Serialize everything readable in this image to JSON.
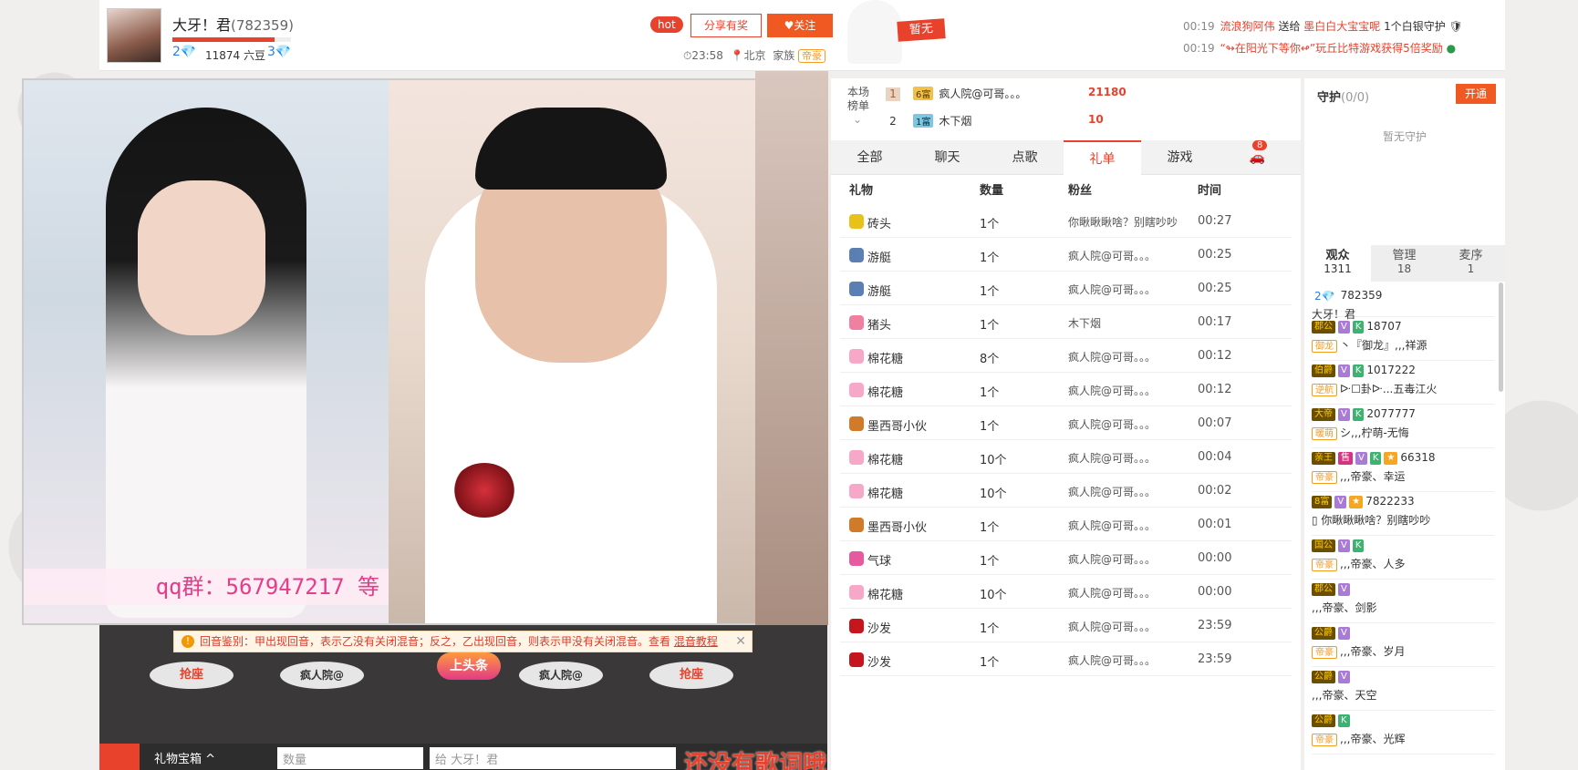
{
  "header": {
    "anchor_name": "大牙！君",
    "anchor_id": "(782359)",
    "level_left": "2💎",
    "beans": "11874 六豆",
    "level_right": "3💎",
    "hot": "hot",
    "share": "分享有奖",
    "follow": "♥关注",
    "time": "⏱23:58",
    "location": "📍北京",
    "family_label": "家族",
    "family_badge": "帝豪",
    "no_badge": "暂无",
    "news": [
      {
        "time": "00:19",
        "parts": [
          "流浪狗阿伟",
          "送给",
          "墨白白大宝宝呢",
          "1个白银守护"
        ]
      },
      {
        "time": "00:19",
        "parts": [
          "“↬在阳光下等你↫”玩丘比特游戏获得5倍奖励"
        ]
      }
    ]
  },
  "video": {
    "qq_text": "qq群：567947217 等"
  },
  "notice": {
    "text": "回音鉴别：甲出现回音，表示乙没有关闭混音；反之，乙出现回音，则表示甲没有关闭混音。查看",
    "link": "混音教程",
    "close": "✕"
  },
  "seats": [
    "抢座",
    "疯人院@",
    "上头条",
    "疯人院@",
    "抢座"
  ],
  "giftbar": {
    "label": "礼物宝箱 ^",
    "qty_placeholder": "数量",
    "to_placeholder": "给 大牙！君"
  },
  "lyric": "还没有歌词哦",
  "rank": {
    "title": "本场榜单",
    "rows": [
      {
        "num": "1",
        "badge": "6富",
        "name": "疯人院@可哥。。。",
        "amount": "21180"
      },
      {
        "num": "2",
        "badge": "1富",
        "name": "木下烟",
        "amount": "10"
      }
    ]
  },
  "tabs": [
    "全部",
    "聊天",
    "点歌",
    "礼单",
    "游戏"
  ],
  "car_badge": "8",
  "gift_headers": [
    "礼物",
    "数量",
    "粉丝",
    "时间"
  ],
  "gifts": [
    {
      "name": "砖头",
      "qty": "1个",
      "fan": "你瞅瞅瞅啥？别瞎吵吵",
      "time": "00:27",
      "color": "#e8c21a"
    },
    {
      "name": "游艇",
      "qty": "1个",
      "fan": "疯人院@可哥。。。",
      "time": "00:25",
      "color": "#5b7fb2"
    },
    {
      "name": "游艇",
      "qty": "1个",
      "fan": "疯人院@可哥。。。",
      "time": "00:25",
      "color": "#5b7fb2"
    },
    {
      "name": "猪头",
      "qty": "1个",
      "fan": "木下烟",
      "time": "00:17",
      "color": "#f080a0"
    },
    {
      "name": "棉花糖",
      "qty": "8个",
      "fan": "疯人院@可哥。。。",
      "time": "00:12",
      "color": "#f7a8c8"
    },
    {
      "name": "棉花糖",
      "qty": "1个",
      "fan": "疯人院@可哥。。。",
      "time": "00:12",
      "color": "#f7a8c8"
    },
    {
      "name": "墨西哥小伙",
      "qty": "1个",
      "fan": "疯人院@可哥。。。",
      "time": "00:07",
      "color": "#d07a2a"
    },
    {
      "name": "棉花糖",
      "qty": "10个",
      "fan": "疯人院@可哥。。。",
      "time": "00:04",
      "color": "#f7a8c8"
    },
    {
      "name": "棉花糖",
      "qty": "10个",
      "fan": "疯人院@可哥。。。",
      "time": "00:02",
      "color": "#f7a8c8"
    },
    {
      "name": "墨西哥小伙",
      "qty": "1个",
      "fan": "疯人院@可哥。。。",
      "time": "00:01",
      "color": "#d07a2a"
    },
    {
      "name": "气球",
      "qty": "1个",
      "fan": "疯人院@可哥。。。",
      "time": "00:00",
      "color": "#e85aa0"
    },
    {
      "name": "棉花糖",
      "qty": "10个",
      "fan": "疯人院@可哥。。。",
      "time": "00:00",
      "color": "#f7a8c8"
    },
    {
      "name": "沙发",
      "qty": "1个",
      "fan": "疯人院@可哥。。。",
      "time": "23:59",
      "color": "#c4161c"
    },
    {
      "name": "沙发",
      "qty": "1个",
      "fan": "疯人院@可哥。。。",
      "time": "23:59",
      "color": "#c4161c"
    }
  ],
  "guard": {
    "title": "守护",
    "count": "(0/0)",
    "open": "开通",
    "none": "暂无守护"
  },
  "audience_tabs": [
    {
      "label": "观众",
      "count": "1311"
    },
    {
      "label": "管理",
      "count": "18"
    },
    {
      "label": "麦序",
      "count": "1"
    }
  ],
  "users": [
    {
      "badges": [
        "2💎"
      ],
      "id": "782359",
      "name": "大牙！君"
    },
    {
      "badges": [
        "郡公",
        "V",
        "K"
      ],
      "id": "18707",
      "tag": "御龙",
      "name": "丶『御龙』,,,祥源"
    },
    {
      "badges": [
        "伯爵",
        "V",
        "K"
      ],
      "id": "1017222",
      "tag": "逆航",
      "name": "ᐓ☐卦ᐓ...五毒江火"
    },
    {
      "badges": [
        "大帝",
        "V",
        "K"
      ],
      "id": "2077777",
      "tag": "暖萌",
      "name": "シ,,,柠萌-无悔"
    },
    {
      "badges": [
        "亲王",
        "售",
        "V",
        "K",
        "★"
      ],
      "id": "66318",
      "tag": "帝豪",
      "name": ",,,帝豪、幸运"
    },
    {
      "badges": [
        "8富",
        "V",
        "★"
      ],
      "id": "7822233",
      "name": "▯ 你瞅瞅瞅啥？别瞎吵吵"
    },
    {
      "badges": [
        "国公",
        "V",
        "K"
      ],
      "id": "",
      "tag": "帝豪",
      "name": ",,,帝豪、人多"
    },
    {
      "badges": [
        "郡公",
        "V"
      ],
      "id": "",
      "name": ",,,帝豪、剑影"
    },
    {
      "badges": [
        "公爵",
        "V"
      ],
      "id": "",
      "tag": "帝豪",
      "name": ",,,帝豪、岁月"
    },
    {
      "badges": [
        "公爵",
        "V"
      ],
      "id": "",
      "name": ",,,帝豪、天空"
    },
    {
      "badges": [
        "公爵",
        "K"
      ],
      "id": "",
      "tag": "帝豪",
      "name": ",,,帝豪、光辉"
    }
  ]
}
